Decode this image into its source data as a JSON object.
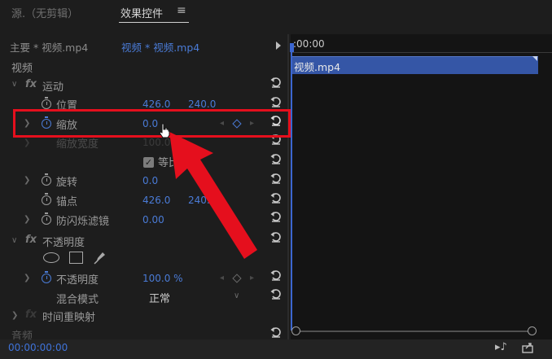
{
  "tabs": {
    "source_label": "源.（无剪辑）",
    "effects_label": "效果控件",
    "menu_icon": "≡"
  },
  "breadcrumb": {
    "master": "主要 * 视频.mp4",
    "clip": "视频 * 视频.mp4"
  },
  "sections": {
    "video_label": "视频",
    "audio_label": "音频"
  },
  "motion": {
    "label": "运动",
    "position": {
      "label": "位置",
      "x": "426.0",
      "y": "240.0"
    },
    "scale": {
      "label": "缩放",
      "value": "0.0"
    },
    "scale_width": {
      "label": "缩放宽度",
      "value": "100.0"
    },
    "uniform_scale": {
      "label": "等比缩放",
      "checked": true
    },
    "rotation": {
      "label": "旋转",
      "value": "0.0"
    },
    "anchor": {
      "label": "锚点",
      "x": "426.0",
      "y": "240.0"
    },
    "anti_flicker": {
      "label": "防闪烁滤镜",
      "value": "0.00"
    }
  },
  "opacity": {
    "label": "不透明度",
    "opacity": {
      "label": "不透明度",
      "value": "100.0 %"
    },
    "blend": {
      "label": "混合模式",
      "value": "正常"
    }
  },
  "time_remap": {
    "label": "时间重映射"
  },
  "timeline": {
    "ruler_time": ":00:00",
    "clip_name": "视频.mp4"
  },
  "footer": {
    "timecode": "00:00:00:00"
  },
  "colors": {
    "accent_blue": "#4a7bd6",
    "clip_blue": "#3556a6",
    "highlight_red": "#e50f1d"
  }
}
